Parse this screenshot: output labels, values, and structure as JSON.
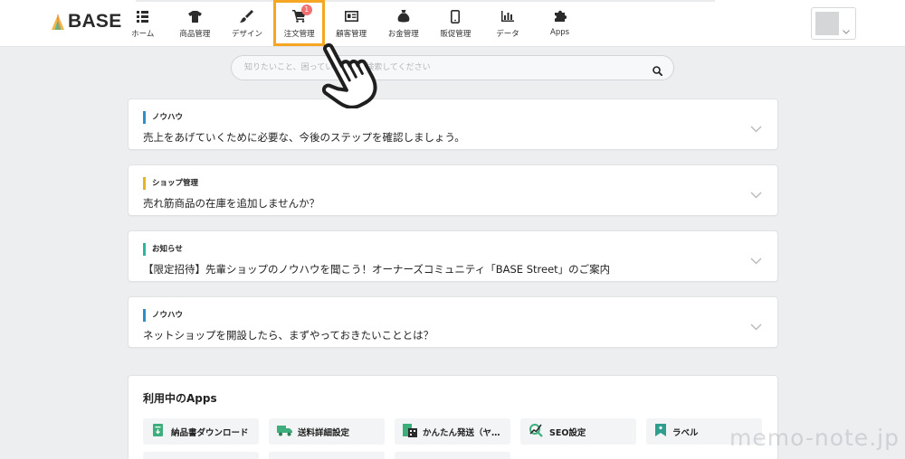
{
  "header": {
    "logo_text": "BASE",
    "nav": [
      {
        "key": "home",
        "label": "ホーム",
        "icon": "grid-icon"
      },
      {
        "key": "products",
        "label": "商品管理",
        "icon": "tshirt-icon"
      },
      {
        "key": "design",
        "label": "デザイン",
        "icon": "paintbrush-icon"
      },
      {
        "key": "orders",
        "label": "注文管理",
        "icon": "cart-icon",
        "badge": "1"
      },
      {
        "key": "customers",
        "label": "顧客管理",
        "icon": "id-card-icon"
      },
      {
        "key": "money",
        "label": "お金管理",
        "icon": "money-bag-icon"
      },
      {
        "key": "promo",
        "label": "販促管理",
        "icon": "smartphone-icon"
      },
      {
        "key": "data",
        "label": "データ",
        "icon": "bar-chart-icon"
      },
      {
        "key": "apps",
        "label": "Apps",
        "icon": "puzzle-icon"
      }
    ],
    "highlight_color": "#f5a623",
    "badge_color": "#f07070"
  },
  "search": {
    "placeholder": "知りたいこと、困っていることを検索してください"
  },
  "notices": [
    {
      "tag": "ノウハウ",
      "tag_color": "#2f8ec7",
      "title": "売上をあげていくために必要な、今後のステップを確認しましょう。"
    },
    {
      "tag": "ショップ管理",
      "tag_color": "#e6b422",
      "title": "売れ筋商品の在庫を追加しませんか？"
    },
    {
      "tag": "お知らせ",
      "tag_color": "#2bb5a0",
      "title": "【限定招待】先輩ショップのノウハウを聞こう！オーナーズコミュニティ「BASE Street」のご案内"
    },
    {
      "tag": "ノウハウ",
      "tag_color": "#2f8ec7",
      "title": "ネットショップを開設したら、まずやっておきたいこととは？"
    }
  ],
  "apps_section": {
    "title": "利用中のApps",
    "apps": [
      {
        "label": "納品書ダウンロード",
        "icon": "document-download-icon"
      },
      {
        "label": "送料詳細設定",
        "icon": "truck-icon"
      },
      {
        "label": "かんたん発送（ヤ…",
        "icon": "qr-box-icon"
      },
      {
        "label": "SEO設定",
        "icon": "seo-icon"
      },
      {
        "label": "ラベル",
        "icon": "label-tag-icon"
      }
    ]
  },
  "watermark": "memo-note.jp"
}
